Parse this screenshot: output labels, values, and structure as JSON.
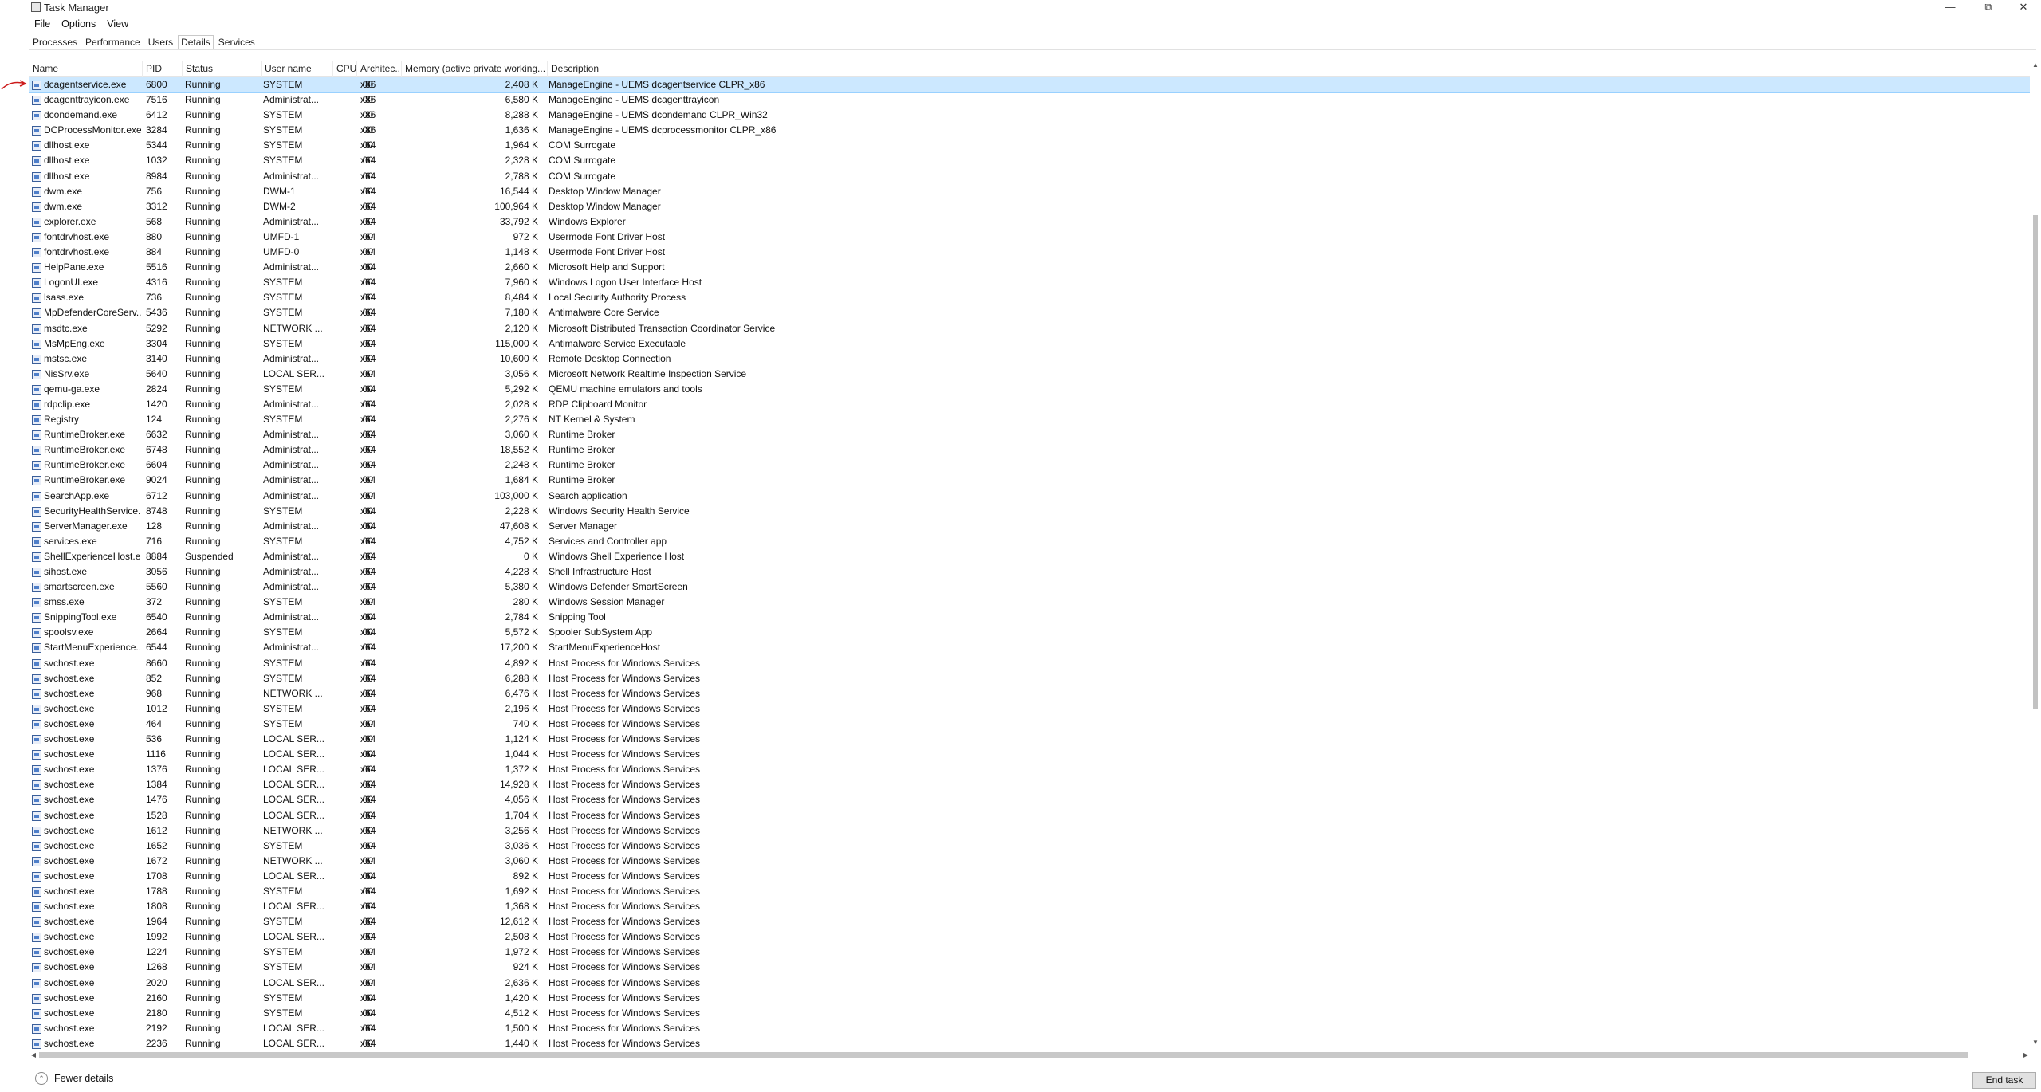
{
  "window": {
    "title": "Task Manager"
  },
  "menu": [
    "File",
    "Options",
    "View"
  ],
  "tabs": [
    "Processes",
    "Performance",
    "Users",
    "Details",
    "Services"
  ],
  "active_tab": "Details",
  "columns": {
    "name": "Name",
    "pid": "PID",
    "status": "Status",
    "user": "User name",
    "cpu": "CPU",
    "arch": "Architec...",
    "memory": "Memory (active private working...",
    "description": "Description"
  },
  "rows": [
    {
      "name": "dcagentservice.exe",
      "pid": "6800",
      "status": "Running",
      "user": "SYSTEM",
      "cpu": "00",
      "arch": "x86",
      "memory": "2,408 K",
      "description": "ManageEngine - UEMS dcagentservice CLPR_x86"
    },
    {
      "name": "dcagenttrayicon.exe",
      "pid": "7516",
      "status": "Running",
      "user": "Administrat...",
      "cpu": "00",
      "arch": "x86",
      "memory": "6,580 K",
      "description": "ManageEngine - UEMS dcagenttrayicon"
    },
    {
      "name": "dcondemand.exe",
      "pid": "6412",
      "status": "Running",
      "user": "SYSTEM",
      "cpu": "00",
      "arch": "x86",
      "memory": "8,288 K",
      "description": "ManageEngine - UEMS dcondemand CLPR_Win32"
    },
    {
      "name": "DCProcessMonitor.exe",
      "pid": "3284",
      "status": "Running",
      "user": "SYSTEM",
      "cpu": "00",
      "arch": "x86",
      "memory": "1,636 K",
      "description": "ManageEngine - UEMS dcprocessmonitor CLPR_x86"
    },
    {
      "name": "dllhost.exe",
      "pid": "5344",
      "status": "Running",
      "user": "SYSTEM",
      "cpu": "00",
      "arch": "x64",
      "memory": "1,964 K",
      "description": "COM Surrogate"
    },
    {
      "name": "dllhost.exe",
      "pid": "1032",
      "status": "Running",
      "user": "SYSTEM",
      "cpu": "00",
      "arch": "x64",
      "memory": "2,328 K",
      "description": "COM Surrogate"
    },
    {
      "name": "dllhost.exe",
      "pid": "8984",
      "status": "Running",
      "user": "Administrat...",
      "cpu": "00",
      "arch": "x64",
      "memory": "2,788 K",
      "description": "COM Surrogate"
    },
    {
      "name": "dwm.exe",
      "pid": "756",
      "status": "Running",
      "user": "DWM-1",
      "cpu": "00",
      "arch": "x64",
      "memory": "16,544 K",
      "description": "Desktop Window Manager"
    },
    {
      "name": "dwm.exe",
      "pid": "3312",
      "status": "Running",
      "user": "DWM-2",
      "cpu": "00",
      "arch": "x64",
      "memory": "100,964 K",
      "description": "Desktop Window Manager"
    },
    {
      "name": "explorer.exe",
      "pid": "568",
      "status": "Running",
      "user": "Administrat...",
      "cpu": "00",
      "arch": "x64",
      "memory": "33,792 K",
      "description": "Windows Explorer"
    },
    {
      "name": "fontdrvhost.exe",
      "pid": "880",
      "status": "Running",
      "user": "UMFD-1",
      "cpu": "00",
      "arch": "x64",
      "memory": "972 K",
      "description": "Usermode Font Driver Host"
    },
    {
      "name": "fontdrvhost.exe",
      "pid": "884",
      "status": "Running",
      "user": "UMFD-0",
      "cpu": "00",
      "arch": "x64",
      "memory": "1,148 K",
      "description": "Usermode Font Driver Host"
    },
    {
      "name": "HelpPane.exe",
      "pid": "5516",
      "status": "Running",
      "user": "Administrat...",
      "cpu": "00",
      "arch": "x64",
      "memory": "2,660 K",
      "description": "Microsoft Help and Support"
    },
    {
      "name": "LogonUI.exe",
      "pid": "4316",
      "status": "Running",
      "user": "SYSTEM",
      "cpu": "00",
      "arch": "x64",
      "memory": "7,960 K",
      "description": "Windows Logon User Interface Host"
    },
    {
      "name": "lsass.exe",
      "pid": "736",
      "status": "Running",
      "user": "SYSTEM",
      "cpu": "00",
      "arch": "x64",
      "memory": "8,484 K",
      "description": "Local Security Authority Process"
    },
    {
      "name": "MpDefenderCoreServ...",
      "pid": "5436",
      "status": "Running",
      "user": "SYSTEM",
      "cpu": "00",
      "arch": "x64",
      "memory": "7,180 K",
      "description": "Antimalware Core Service"
    },
    {
      "name": "msdtc.exe",
      "pid": "5292",
      "status": "Running",
      "user": "NETWORK ...",
      "cpu": "00",
      "arch": "x64",
      "memory": "2,120 K",
      "description": "Microsoft Distributed Transaction Coordinator Service"
    },
    {
      "name": "MsMpEng.exe",
      "pid": "3304",
      "status": "Running",
      "user": "SYSTEM",
      "cpu": "00",
      "arch": "x64",
      "memory": "115,000 K",
      "description": "Antimalware Service Executable"
    },
    {
      "name": "mstsc.exe",
      "pid": "3140",
      "status": "Running",
      "user": "Administrat...",
      "cpu": "00",
      "arch": "x64",
      "memory": "10,600 K",
      "description": "Remote Desktop Connection"
    },
    {
      "name": "NisSrv.exe",
      "pid": "5640",
      "status": "Running",
      "user": "LOCAL SER...",
      "cpu": "00",
      "arch": "x64",
      "memory": "3,056 K",
      "description": "Microsoft Network Realtime Inspection Service"
    },
    {
      "name": "qemu-ga.exe",
      "pid": "2824",
      "status": "Running",
      "user": "SYSTEM",
      "cpu": "00",
      "arch": "x64",
      "memory": "5,292 K",
      "description": "QEMU machine emulators and tools"
    },
    {
      "name": "rdpclip.exe",
      "pid": "1420",
      "status": "Running",
      "user": "Administrat...",
      "cpu": "00",
      "arch": "x64",
      "memory": "2,028 K",
      "description": "RDP Clipboard Monitor"
    },
    {
      "name": "Registry",
      "pid": "124",
      "status": "Running",
      "user": "SYSTEM",
      "cpu": "00",
      "arch": "x64",
      "memory": "2,276 K",
      "description": "NT Kernel & System"
    },
    {
      "name": "RuntimeBroker.exe",
      "pid": "6632",
      "status": "Running",
      "user": "Administrat...",
      "cpu": "00",
      "arch": "x64",
      "memory": "3,060 K",
      "description": "Runtime Broker"
    },
    {
      "name": "RuntimeBroker.exe",
      "pid": "6748",
      "status": "Running",
      "user": "Administrat...",
      "cpu": "00",
      "arch": "x64",
      "memory": "18,552 K",
      "description": "Runtime Broker"
    },
    {
      "name": "RuntimeBroker.exe",
      "pid": "6604",
      "status": "Running",
      "user": "Administrat...",
      "cpu": "00",
      "arch": "x64",
      "memory": "2,248 K",
      "description": "Runtime Broker"
    },
    {
      "name": "RuntimeBroker.exe",
      "pid": "9024",
      "status": "Running",
      "user": "Administrat...",
      "cpu": "00",
      "arch": "x64",
      "memory": "1,684 K",
      "description": "Runtime Broker"
    },
    {
      "name": "SearchApp.exe",
      "pid": "6712",
      "status": "Running",
      "user": "Administrat...",
      "cpu": "00",
      "arch": "x64",
      "memory": "103,000 K",
      "description": "Search application"
    },
    {
      "name": "SecurityHealthService...",
      "pid": "8748",
      "status": "Running",
      "user": "SYSTEM",
      "cpu": "00",
      "arch": "x64",
      "memory": "2,228 K",
      "description": "Windows Security Health Service"
    },
    {
      "name": "ServerManager.exe",
      "pid": "128",
      "status": "Running",
      "user": "Administrat...",
      "cpu": "00",
      "arch": "x64",
      "memory": "47,608 K",
      "description": "Server Manager"
    },
    {
      "name": "services.exe",
      "pid": "716",
      "status": "Running",
      "user": "SYSTEM",
      "cpu": "00",
      "arch": "x64",
      "memory": "4,752 K",
      "description": "Services and Controller app"
    },
    {
      "name": "ShellExperienceHost.e...",
      "pid": "8884",
      "status": "Suspended",
      "user": "Administrat...",
      "cpu": "00",
      "arch": "x64",
      "memory": "0 K",
      "description": "Windows Shell Experience Host"
    },
    {
      "name": "sihost.exe",
      "pid": "3056",
      "status": "Running",
      "user": "Administrat...",
      "cpu": "00",
      "arch": "x64",
      "memory": "4,228 K",
      "description": "Shell Infrastructure Host"
    },
    {
      "name": "smartscreen.exe",
      "pid": "5560",
      "status": "Running",
      "user": "Administrat...",
      "cpu": "00",
      "arch": "x64",
      "memory": "5,380 K",
      "description": "Windows Defender SmartScreen"
    },
    {
      "name": "smss.exe",
      "pid": "372",
      "status": "Running",
      "user": "SYSTEM",
      "cpu": "00",
      "arch": "x64",
      "memory": "280 K",
      "description": "Windows Session Manager"
    },
    {
      "name": "SnippingTool.exe",
      "pid": "6540",
      "status": "Running",
      "user": "Administrat...",
      "cpu": "00",
      "arch": "x64",
      "memory": "2,784 K",
      "description": "Snipping Tool"
    },
    {
      "name": "spoolsv.exe",
      "pid": "2664",
      "status": "Running",
      "user": "SYSTEM",
      "cpu": "00",
      "arch": "x64",
      "memory": "5,572 K",
      "description": "Spooler SubSystem App"
    },
    {
      "name": "StartMenuExperience...",
      "pid": "6544",
      "status": "Running",
      "user": "Administrat...",
      "cpu": "00",
      "arch": "x64",
      "memory": "17,200 K",
      "description": "StartMenuExperienceHost"
    },
    {
      "name": "svchost.exe",
      "pid": "8660",
      "status": "Running",
      "user": "SYSTEM",
      "cpu": "00",
      "arch": "x64",
      "memory": "4,892 K",
      "description": "Host Process for Windows Services"
    },
    {
      "name": "svchost.exe",
      "pid": "852",
      "status": "Running",
      "user": "SYSTEM",
      "cpu": "00",
      "arch": "x64",
      "memory": "6,288 K",
      "description": "Host Process for Windows Services"
    },
    {
      "name": "svchost.exe",
      "pid": "968",
      "status": "Running",
      "user": "NETWORK ...",
      "cpu": "00",
      "arch": "x64",
      "memory": "6,476 K",
      "description": "Host Process for Windows Services"
    },
    {
      "name": "svchost.exe",
      "pid": "1012",
      "status": "Running",
      "user": "SYSTEM",
      "cpu": "00",
      "arch": "x64",
      "memory": "2,196 K",
      "description": "Host Process for Windows Services"
    },
    {
      "name": "svchost.exe",
      "pid": "464",
      "status": "Running",
      "user": "SYSTEM",
      "cpu": "00",
      "arch": "x64",
      "memory": "740 K",
      "description": "Host Process for Windows Services"
    },
    {
      "name": "svchost.exe",
      "pid": "536",
      "status": "Running",
      "user": "LOCAL SER...",
      "cpu": "00",
      "arch": "x64",
      "memory": "1,124 K",
      "description": "Host Process for Windows Services"
    },
    {
      "name": "svchost.exe",
      "pid": "1116",
      "status": "Running",
      "user": "LOCAL SER...",
      "cpu": "00",
      "arch": "x64",
      "memory": "1,044 K",
      "description": "Host Process for Windows Services"
    },
    {
      "name": "svchost.exe",
      "pid": "1376",
      "status": "Running",
      "user": "LOCAL SER...",
      "cpu": "00",
      "arch": "x64",
      "memory": "1,372 K",
      "description": "Host Process for Windows Services"
    },
    {
      "name": "svchost.exe",
      "pid": "1384",
      "status": "Running",
      "user": "LOCAL SER...",
      "cpu": "00",
      "arch": "x64",
      "memory": "14,928 K",
      "description": "Host Process for Windows Services"
    },
    {
      "name": "svchost.exe",
      "pid": "1476",
      "status": "Running",
      "user": "LOCAL SER...",
      "cpu": "00",
      "arch": "x64",
      "memory": "4,056 K",
      "description": "Host Process for Windows Services"
    },
    {
      "name": "svchost.exe",
      "pid": "1528",
      "status": "Running",
      "user": "LOCAL SER...",
      "cpu": "00",
      "arch": "x64",
      "memory": "1,704 K",
      "description": "Host Process for Windows Services"
    },
    {
      "name": "svchost.exe",
      "pid": "1612",
      "status": "Running",
      "user": "NETWORK ...",
      "cpu": "00",
      "arch": "x64",
      "memory": "3,256 K",
      "description": "Host Process for Windows Services"
    },
    {
      "name": "svchost.exe",
      "pid": "1652",
      "status": "Running",
      "user": "SYSTEM",
      "cpu": "00",
      "arch": "x64",
      "memory": "3,036 K",
      "description": "Host Process for Windows Services"
    },
    {
      "name": "svchost.exe",
      "pid": "1672",
      "status": "Running",
      "user": "NETWORK ...",
      "cpu": "00",
      "arch": "x64",
      "memory": "3,060 K",
      "description": "Host Process for Windows Services"
    },
    {
      "name": "svchost.exe",
      "pid": "1708",
      "status": "Running",
      "user": "LOCAL SER...",
      "cpu": "00",
      "arch": "x64",
      "memory": "892 K",
      "description": "Host Process for Windows Services"
    },
    {
      "name": "svchost.exe",
      "pid": "1788",
      "status": "Running",
      "user": "SYSTEM",
      "cpu": "00",
      "arch": "x64",
      "memory": "1,692 K",
      "description": "Host Process for Windows Services"
    },
    {
      "name": "svchost.exe",
      "pid": "1808",
      "status": "Running",
      "user": "LOCAL SER...",
      "cpu": "00",
      "arch": "x64",
      "memory": "1,368 K",
      "description": "Host Process for Windows Services"
    },
    {
      "name": "svchost.exe",
      "pid": "1964",
      "status": "Running",
      "user": "SYSTEM",
      "cpu": "00",
      "arch": "x64",
      "memory": "12,612 K",
      "description": "Host Process for Windows Services"
    },
    {
      "name": "svchost.exe",
      "pid": "1992",
      "status": "Running",
      "user": "LOCAL SER...",
      "cpu": "00",
      "arch": "x64",
      "memory": "2,508 K",
      "description": "Host Process for Windows Services"
    },
    {
      "name": "svchost.exe",
      "pid": "1224",
      "status": "Running",
      "user": "SYSTEM",
      "cpu": "00",
      "arch": "x64",
      "memory": "1,972 K",
      "description": "Host Process for Windows Services"
    },
    {
      "name": "svchost.exe",
      "pid": "1268",
      "status": "Running",
      "user": "SYSTEM",
      "cpu": "00",
      "arch": "x64",
      "memory": "924 K",
      "description": "Host Process for Windows Services"
    },
    {
      "name": "svchost.exe",
      "pid": "2020",
      "status": "Running",
      "user": "LOCAL SER...",
      "cpu": "00",
      "arch": "x64",
      "memory": "2,636 K",
      "description": "Host Process for Windows Services"
    },
    {
      "name": "svchost.exe",
      "pid": "2160",
      "status": "Running",
      "user": "SYSTEM",
      "cpu": "00",
      "arch": "x64",
      "memory": "1,420 K",
      "description": "Host Process for Windows Services"
    },
    {
      "name": "svchost.exe",
      "pid": "2180",
      "status": "Running",
      "user": "SYSTEM",
      "cpu": "00",
      "arch": "x64",
      "memory": "4,512 K",
      "description": "Host Process for Windows Services"
    },
    {
      "name": "svchost.exe",
      "pid": "2192",
      "status": "Running",
      "user": "LOCAL SER...",
      "cpu": "00",
      "arch": "x64",
      "memory": "1,500 K",
      "description": "Host Process for Windows Services"
    },
    {
      "name": "svchost.exe",
      "pid": "2236",
      "status": "Running",
      "user": "LOCAL SER...",
      "cpu": "00",
      "arch": "x64",
      "memory": "1,440 K",
      "description": "Host Process for Windows Services"
    }
  ],
  "footer": {
    "fewer_details": "Fewer details",
    "end_task": "End task"
  },
  "colors": {
    "selected_row": "#cce8ff",
    "annotation_arrow": "#cc1b1b"
  }
}
